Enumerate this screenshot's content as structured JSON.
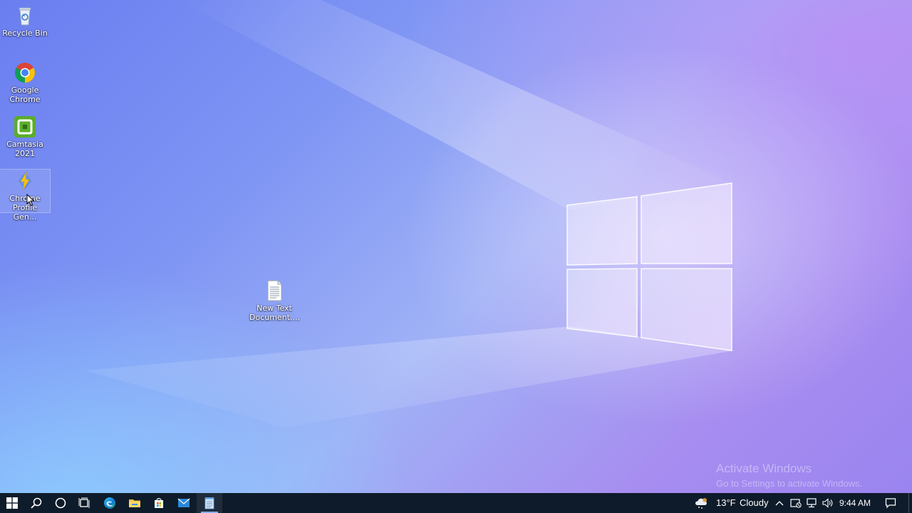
{
  "desktop": {
    "icons": [
      {
        "id": "recycle-bin",
        "label": "Recycle Bin",
        "icon": "recycle-bin-icon"
      },
      {
        "id": "google-chrome",
        "label": "Google Chrome",
        "icon": "chrome-icon"
      },
      {
        "id": "camtasia",
        "label": "Camtasia 2021",
        "icon": "camtasia-icon"
      },
      {
        "id": "chrome-profile-gen",
        "label": "Chrome Profile Gen...",
        "icon": "lightning-icon",
        "selected": true
      },
      {
        "id": "new-text-document",
        "label": "New Text Document....",
        "icon": "text-file-icon"
      }
    ],
    "wallpaper": "windows-10-light-wallpaper"
  },
  "watermark": {
    "title": "Activate Windows",
    "subtitle": "Go to Settings to activate Windows."
  },
  "taskbar": {
    "apps": [
      {
        "id": "start",
        "icon": "windows-start-icon"
      },
      {
        "id": "search",
        "icon": "search-icon"
      },
      {
        "id": "cortana",
        "icon": "cortana-circle-icon"
      },
      {
        "id": "task-view",
        "icon": "task-view-icon"
      },
      {
        "id": "edge",
        "icon": "edge-icon"
      },
      {
        "id": "file-explorer",
        "icon": "folder-icon"
      },
      {
        "id": "store",
        "icon": "store-icon"
      },
      {
        "id": "mail",
        "icon": "mail-icon"
      },
      {
        "id": "notepad",
        "icon": "notepad-icon",
        "active": true
      }
    ],
    "weather": {
      "temperature": "13°F",
      "condition": "Cloudy",
      "icon": "cloud-snow-icon"
    },
    "tray_icons": [
      "chevron-up-icon",
      "security-icon",
      "network-icon",
      "volume-icon"
    ],
    "clock": {
      "time": "9:44 AM"
    },
    "notification_icon": "action-center-icon"
  },
  "colors": {
    "taskbar_bg": "#0e1b2a",
    "accent": "#7fb3ff"
  }
}
